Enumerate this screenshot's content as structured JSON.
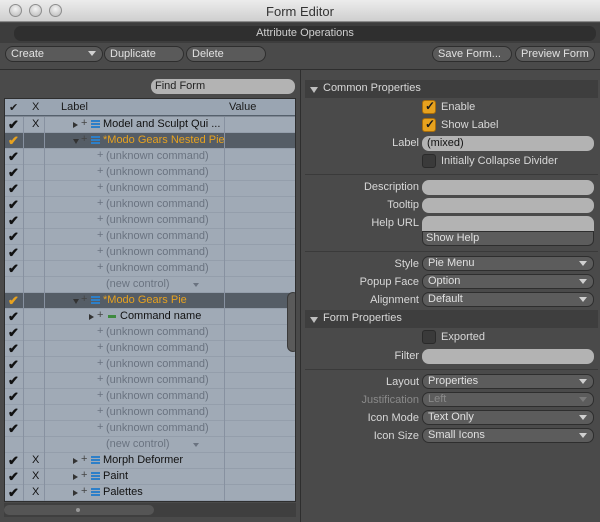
{
  "window": {
    "title": "Form Editor",
    "attribute_operations": "Attribute Operations"
  },
  "toolbar": {
    "create": "Create",
    "duplicate": "Duplicate",
    "delete": "Delete",
    "save_form": "Save Form...",
    "preview_form": "Preview Form"
  },
  "left": {
    "find_form": "Find Form",
    "columns": {
      "check": "✔",
      "x": "X",
      "label": "Label",
      "value": "Value"
    },
    "rows": [
      {
        "check": "✔",
        "x": "X",
        "label": "Model and Sculpt Qui ...",
        "kind": "form",
        "depth": 0,
        "expanded": false,
        "selected": false
      },
      {
        "check": "✔",
        "x": "",
        "label": "*Modo Gears Nested Pie",
        "kind": "form",
        "depth": 0,
        "expanded": true,
        "selected": true
      },
      {
        "check": "✔",
        "x": "",
        "label": "(unknown command)",
        "kind": "unknown",
        "depth": 1,
        "selected": false
      },
      {
        "check": "✔",
        "x": "",
        "label": "(unknown command)",
        "kind": "unknown",
        "depth": 1,
        "selected": false
      },
      {
        "check": "✔",
        "x": "",
        "label": "(unknown command)",
        "kind": "unknown",
        "depth": 1,
        "selected": false
      },
      {
        "check": "✔",
        "x": "",
        "label": "(unknown command)",
        "kind": "unknown",
        "depth": 1,
        "selected": false
      },
      {
        "check": "✔",
        "x": "",
        "label": "(unknown command)",
        "kind": "unknown",
        "depth": 1,
        "selected": false
      },
      {
        "check": "✔",
        "x": "",
        "label": "(unknown command)",
        "kind": "unknown",
        "depth": 1,
        "selected": false
      },
      {
        "check": "✔",
        "x": "",
        "label": "(unknown command)",
        "kind": "unknown",
        "depth": 1,
        "selected": false
      },
      {
        "check": "✔",
        "x": "",
        "label": "(unknown command)",
        "kind": "unknown",
        "depth": 1,
        "selected": false
      },
      {
        "check": "",
        "x": "",
        "label": "(new control)",
        "kind": "new",
        "depth": 1,
        "selected": false
      },
      {
        "check": "✔",
        "x": "",
        "label": "*Modo Gears Pie",
        "kind": "form",
        "depth": 0,
        "expanded": true,
        "selected": true
      },
      {
        "check": "✔",
        "x": "",
        "label": "Command name",
        "kind": "command",
        "depth": 1,
        "selected": false
      },
      {
        "check": "✔",
        "x": "",
        "label": "(unknown command)",
        "kind": "unknown",
        "depth": 1,
        "selected": false
      },
      {
        "check": "✔",
        "x": "",
        "label": "(unknown command)",
        "kind": "unknown",
        "depth": 1,
        "selected": false
      },
      {
        "check": "✔",
        "x": "",
        "label": "(unknown command)",
        "kind": "unknown",
        "depth": 1,
        "selected": false
      },
      {
        "check": "✔",
        "x": "",
        "label": "(unknown command)",
        "kind": "unknown",
        "depth": 1,
        "selected": false
      },
      {
        "check": "✔",
        "x": "",
        "label": "(unknown command)",
        "kind": "unknown",
        "depth": 1,
        "selected": false
      },
      {
        "check": "✔",
        "x": "",
        "label": "(unknown command)",
        "kind": "unknown",
        "depth": 1,
        "selected": false
      },
      {
        "check": "✔",
        "x": "",
        "label": "(unknown command)",
        "kind": "unknown",
        "depth": 1,
        "selected": false
      },
      {
        "check": "",
        "x": "",
        "label": "(new control)",
        "kind": "new",
        "depth": 1,
        "selected": false
      },
      {
        "check": "✔",
        "x": "X",
        "label": "Morph Deformer",
        "kind": "form",
        "depth": 0,
        "expanded": false,
        "selected": false
      },
      {
        "check": "✔",
        "x": "X",
        "label": "Paint",
        "kind": "form",
        "depth": 0,
        "expanded": false,
        "selected": false
      },
      {
        "check": "✔",
        "x": "X",
        "label": "Palettes",
        "kind": "form",
        "depth": 0,
        "expanded": false,
        "selected": false
      }
    ]
  },
  "common": {
    "header": "Common Properties",
    "enable_label": "Enable",
    "enable_checked": true,
    "show_label_label": "Show Label",
    "show_label_checked": true,
    "label_label": "Label",
    "label_value": "(mixed)",
    "collapse_label": "Initially Collapse Divider",
    "collapse_checked": false,
    "description_label": "Description",
    "description_value": "",
    "tooltip_label": "Tooltip",
    "tooltip_value": "",
    "helpurl_label": "Help URL",
    "helpurl_value": "",
    "show_help": "Show Help",
    "style_label": "Style",
    "style_value": "Pie Menu",
    "popup_label": "Popup Face",
    "popup_value": "Option",
    "alignment_label": "Alignment",
    "alignment_value": "Default"
  },
  "form": {
    "header": "Form Properties",
    "exported_label": "Exported",
    "exported_checked": false,
    "filter_label": "Filter",
    "filter_value": "",
    "layout_label": "Layout",
    "layout_value": "Properties",
    "justification_label": "Justification",
    "justification_value": "Left",
    "iconmode_label": "Icon Mode",
    "iconmode_value": "Text Only",
    "iconsize_label": "Icon Size",
    "iconsize_value": "Small Icons"
  },
  "colors": {
    "accent": "#e7a21f",
    "tree_bg": "#a0aab6",
    "selected_row": "#555d66",
    "panel_bg": "#4a4a4a"
  }
}
